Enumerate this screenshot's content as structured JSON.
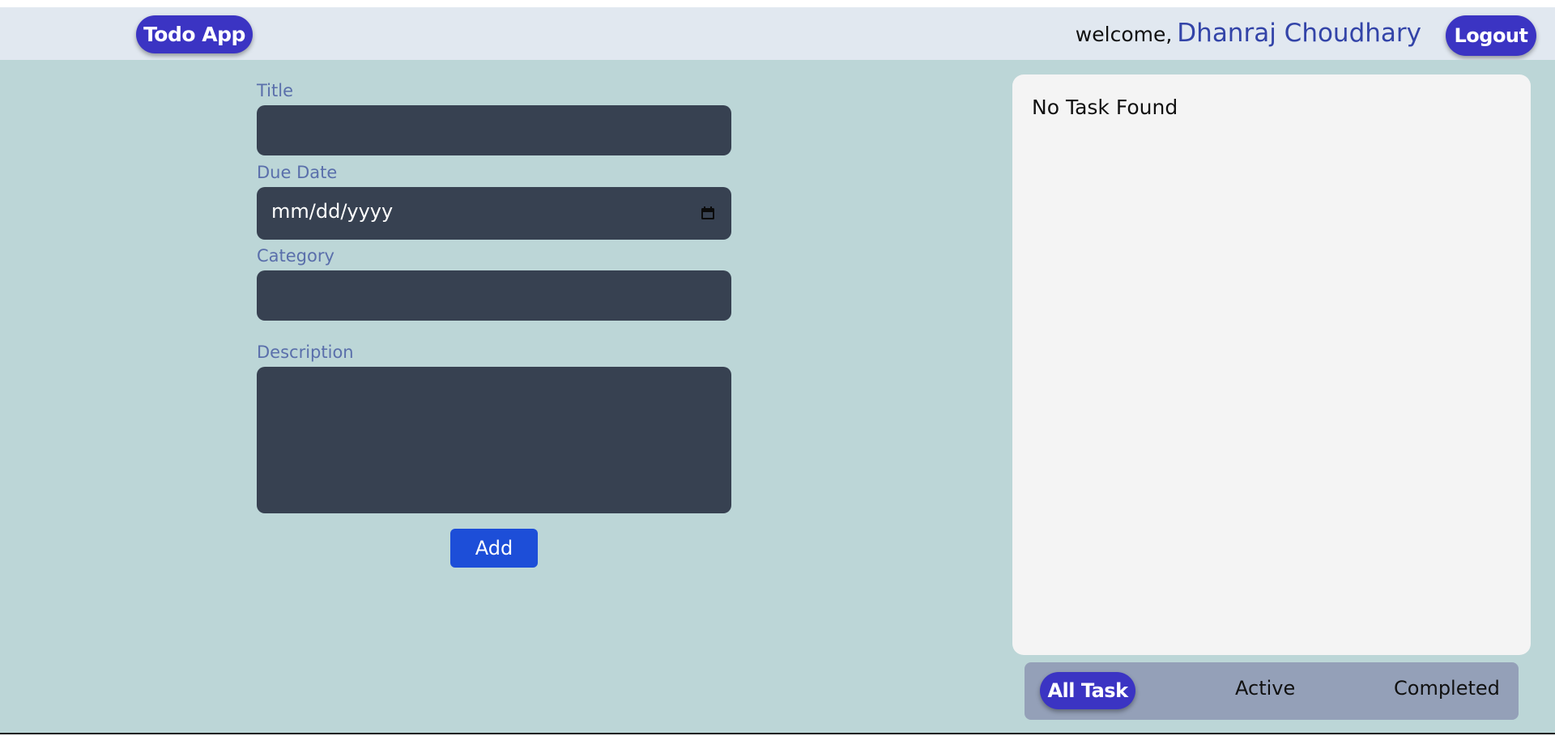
{
  "header": {
    "brand_label": "Todo App",
    "welcome_text": "welcome,",
    "user_name": "Dhanraj Choudhary",
    "logout_label": "Logout"
  },
  "form": {
    "title_label": "Title",
    "title_value": "",
    "due_date_label": "Due Date",
    "due_date_placeholder": "mm/dd/yyyy",
    "category_label": "Category",
    "category_value": "",
    "description_label": "Description",
    "description_value": "",
    "add_label": "Add"
  },
  "tasks": {
    "empty_message": "No Task Found",
    "items": []
  },
  "filters": {
    "all_label": "All Task",
    "active_label": "Active",
    "completed_label": "Completed",
    "selected": "All Task"
  },
  "colors": {
    "accent": "#3b34c3",
    "add_button": "#1d4ed8",
    "input_bg": "#374151",
    "page_bg": "#bcd6d7",
    "navbar_bg": "#e1e8f0",
    "label_color": "#5a6fab"
  },
  "icons": {
    "date_picker": "calendar-icon"
  }
}
